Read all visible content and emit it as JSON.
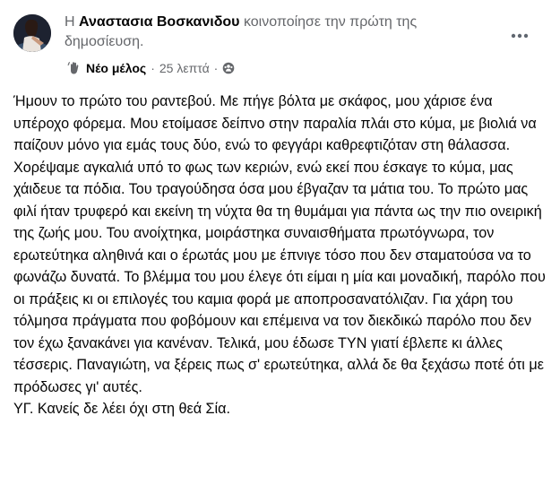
{
  "post": {
    "author_prefix": "Η",
    "author_name": "Αναστασια Βοσκανιδου",
    "action_text": "κοινοποίησε την πρώτη της δημοσίευση.",
    "role_icon": "wave-hand-icon",
    "role_label": "Νέο μέλος",
    "separator": "·",
    "time": "25 λεπτά",
    "audience_icon": "group-audience-icon",
    "more_icon": "more-options-icon",
    "body": "Ήμουν το πρώτο του ραντεβού. Με πήγε βόλτα με σκάφος, μου χάρισε ένα υπέροχο φόρεμα. Μου ετοίμασε δείπνο στην παραλία πλάι στο κύμα, με βιολιά να παίζουν μόνο για εμάς τους δύο, ενώ το φεγγάρι καθρεφτιζόταν στη θάλασσα. Χορέψαμε αγκαλιά υπό το φως των κεριών, ενώ εκεί που έσκαγε το κύμα, μας χάιδευε τα πόδια. Του τραγούδησα όσα μου έβγαζαν τα μάτια του. Το πρώτο μας φιλί ήταν τρυφερό και εκείνη τη νύχτα θα τη θυμάμαι για πάντα ως την πιο ονειρική της ζωής μου.  Του ανοίχτηκα, μοιράστηκα συναισθήματα πρωτόγνωρα, τον ερωτεύτηκα αληθινά και ο έρωτάς μου με έπνιγε τόσο που δεν σταματούσα να το φωνάζω δυνατά. Το βλέμμα του μου έλεγε ότι είμαι η μία και μοναδική, παρόλο που οι πράξεις κι οι επιλογές του καμια φορά με αποπροσανατόλιζαν. Για χάρη του τόλμησα πράγματα που φοβόμουν και επέμεινα να τον διεκδικώ παρόλο που δεν τον έχω ξανακάνει για κανέναν. Τελικά, μου έδωσε ΤΥΝ γιατί έβλεπε κι άλλες τέσσερις. Παναγιώτη, να ξέρεις πως σ' ερωτεύτηκα, αλλά δε θα ξεχάσω ποτέ ότι με πρόδωσες γι' αυτές.",
    "ps": "ΥΓ. Κανείς δε λέει όχι στη θεά Σία."
  }
}
